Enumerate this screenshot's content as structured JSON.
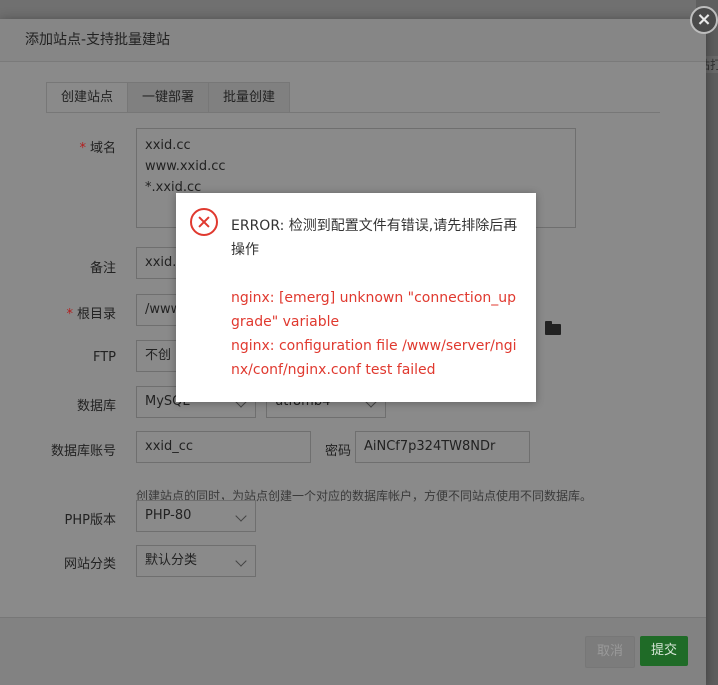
{
  "backdrop": {
    "edge_text": "站打"
  },
  "dialog": {
    "title": "添加站点-支持批量建站",
    "close_glyph": "×",
    "tabs": [
      "创建站点",
      "一键部署",
      "批量创建"
    ],
    "domain": {
      "label": "域名",
      "required_mark": "*",
      "lines": [
        "xxid.cc",
        "www.xxid.cc",
        "*.xxid.cc"
      ]
    },
    "remark": {
      "label": "备注",
      "value": "xxid.c"
    },
    "root_dir": {
      "label": "根目录",
      "required_mark": "*",
      "value": "/www"
    },
    "ftp": {
      "label": "FTP",
      "value": "不创"
    },
    "database": {
      "label": "数据库",
      "type": "MySQL",
      "charset": "utf8mb4"
    },
    "db_account": {
      "label": "数据库账号",
      "value": "xxid_cc",
      "password_label": "密码",
      "password": "AiNCf7p324TW8NDr"
    },
    "hint": "创建站点的同时，为站点创建一个对应的数据库帐户，方便不同站点使用不同数据库。",
    "php": {
      "label": "PHP版本",
      "value": "PHP-80"
    },
    "category": {
      "label": "网站分类",
      "value": "默认分类"
    },
    "cancel_label": "取消",
    "submit_label": "提交"
  },
  "error_popup": {
    "title": "ERROR: 检测到配置文件有错误,请先排除后再操作",
    "detail_lines": [
      "nginx: [emerg] unknown \"connection_upgrade\" variable",
      "nginx: configuration file /www/server/nginx/conf/nginx.conf test failed"
    ]
  },
  "colors": {
    "error": "#e0392f",
    "submit": "#20a53a",
    "required": "#e4393c"
  }
}
